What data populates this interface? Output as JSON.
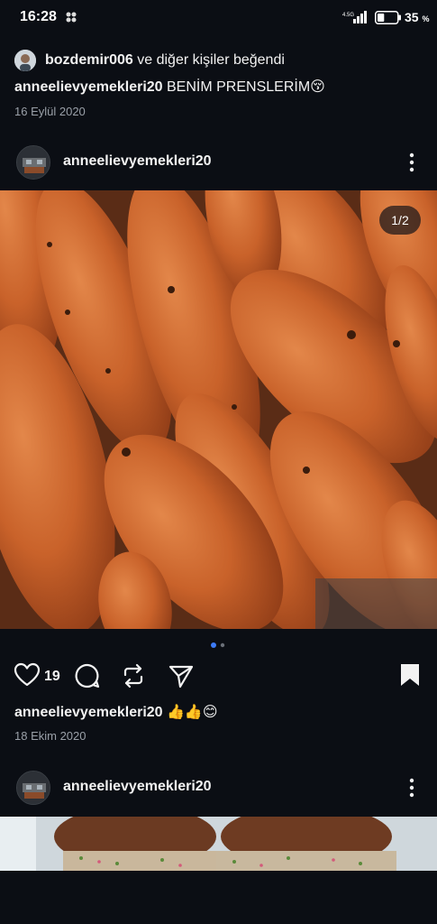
{
  "status_bar": {
    "time": "16:28",
    "network": "4.5G",
    "battery_percent": "35",
    "battery_suffix": "%",
    "battery_level": 0.35
  },
  "liked_by": {
    "username": "bozdemir006",
    "suffix": " ve diğer kişiler beğendi"
  },
  "post1_caption": {
    "username": "anneelievyemekleri20",
    "text": " BENİM PRENSLERİM😚",
    "date": "16 Eylül 2020"
  },
  "post2": {
    "username": "anneelievyemekleri20",
    "image_counter": "1/2",
    "like_count": "19",
    "caption_username": "anneelievyemekleri20",
    "caption_text": " 👍👍😊",
    "date": "18 Ekim 2020"
  },
  "post3": {
    "username": "anneelievyemekleri20"
  },
  "icons": {
    "like": "heart-icon",
    "comment": "comment-icon",
    "repost": "repost-icon",
    "share": "send-icon",
    "save": "bookmark-icon",
    "more": "more-vertical-icon"
  },
  "colors": {
    "background": "#0b0e14",
    "text_primary": "#f2f2f2",
    "text_secondary": "#9aa0a8",
    "carousel_dot_active": "#3d7bf7"
  }
}
